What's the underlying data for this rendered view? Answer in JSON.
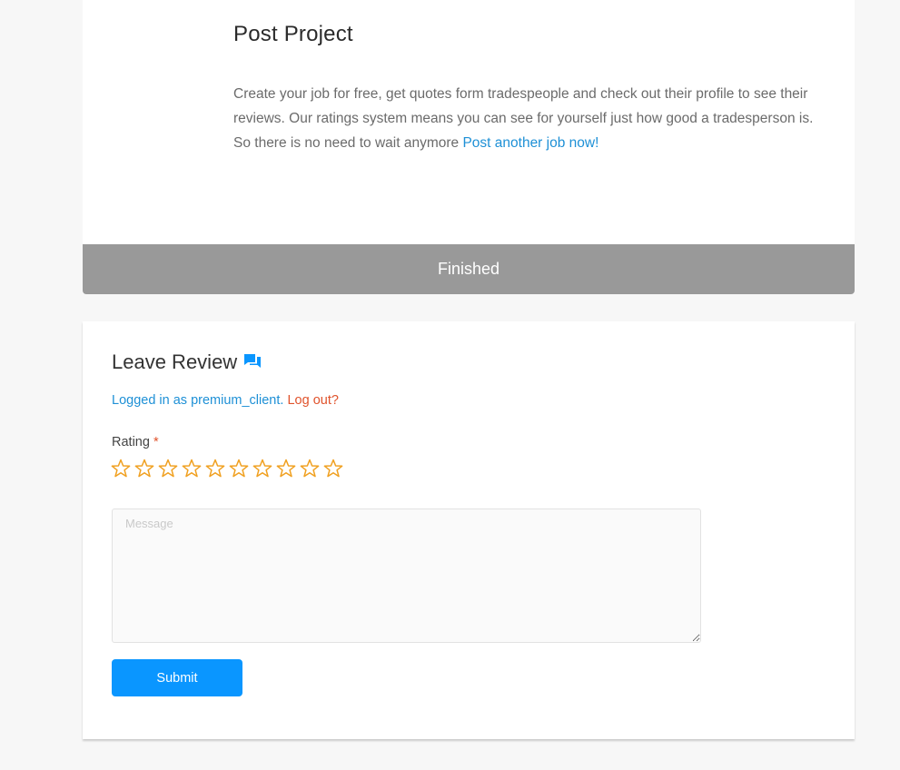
{
  "project": {
    "title": "Post Project",
    "description": "Create your job for free, get quotes form tradespeople and check out their profile to see their reviews. Our ratings system means you can see for yourself just how good a tradesperson is. So there is no need to wait anymore ",
    "cta_link": "Post another job now!"
  },
  "status": {
    "label": "Finished",
    "color": "#999999"
  },
  "review": {
    "title": "Leave Review",
    "title_icon": "chat-bubbles-icon",
    "logged_in_prefix": "Logged in as ",
    "username": "premium_client",
    "logout_label": "Log out?",
    "rating_label": "Rating",
    "required_mark": "*",
    "star_count": 10,
    "star_color": "#f0a020",
    "message_placeholder": "Message",
    "message_value": "",
    "submit_label": "Submit"
  },
  "colors": {
    "accent": "#0a96ff",
    "link": "#1e90d6",
    "danger": "#e0532c"
  }
}
